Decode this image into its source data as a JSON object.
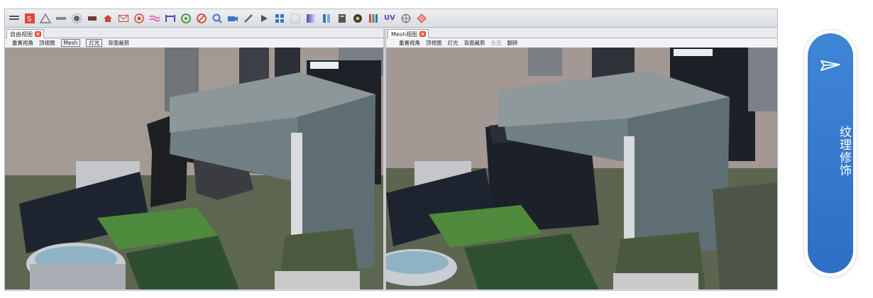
{
  "colors": {
    "accent_blue": "#3a7dd0",
    "tab_close_red": "#e7462e",
    "viewport_background": "#a49a94"
  },
  "toolbar": {
    "icons": [
      "grid-icon",
      "snapshot-icon",
      "warning-triangle-icon",
      "ruler-icon",
      "sun-icon",
      "battery-icon",
      "house-icon",
      "mail-icon",
      "target-icon",
      "waves-icon",
      "bridge-icon",
      "disc-icon",
      "cancel-icon",
      "zoom-icon",
      "camera-icon",
      "brush-icon",
      "play-icon",
      "grid-tiles-icon",
      "dotted-grid-icon",
      "gradient-icon",
      "layers-icon",
      "database-icon",
      "settings-wheel-icon",
      "color-bars-icon",
      "uv-icon",
      "compass-icon",
      "diamond-icon"
    ],
    "uv_label": "UV"
  },
  "left_panel": {
    "tab_title": "自由视图",
    "view_buttons": [
      "重置视角",
      "顶视图",
      "Mesh",
      "灯光",
      "背面裁剪"
    ]
  },
  "right_panel": {
    "tab_title": "Mesh视图",
    "view_buttons": [
      "重置视角",
      "顶视图",
      "灯光",
      "背面裁剪",
      "全选",
      "翻转"
    ]
  },
  "side_button": {
    "label": "纹理修饰",
    "icon": "paper-plane-icon"
  }
}
